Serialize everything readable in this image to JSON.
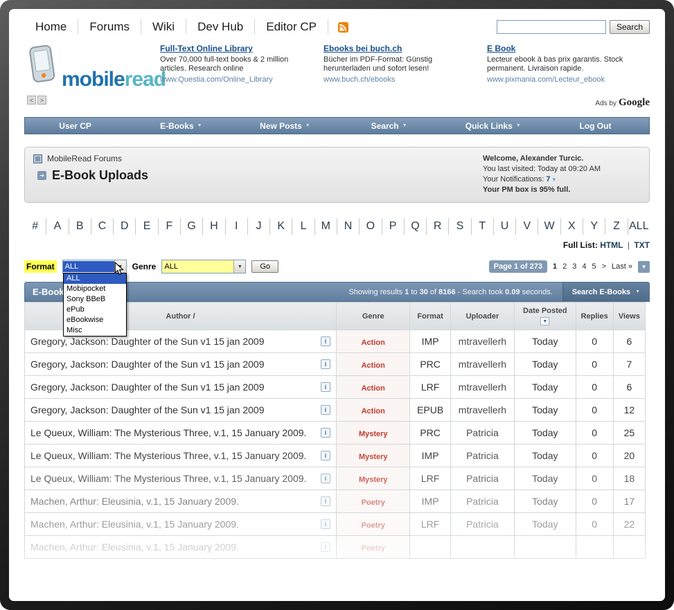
{
  "topnav": {
    "items": [
      "Home",
      "Forums",
      "Wiki",
      "Dev Hub",
      "Editor CP"
    ],
    "search_value": "",
    "search_button": "Search"
  },
  "logo": {
    "text_mobile": "mobile",
    "text_read": "read",
    "pager_prev": "<",
    "pager_next": ">"
  },
  "ads": {
    "byline_prefix": "Ads by",
    "byline_brand": "Google",
    "items": [
      {
        "title": "Full-Text Online Library",
        "body": "Over 70,000 full-text books & 2 million articles. Research online",
        "url": "www.Questia.com/Online_Library"
      },
      {
        "title": "Ebooks bei buch.ch",
        "body": "Bücher im PDF-Format: Günstig herunterladen und sofort lesen!",
        "url": "www.buch.ch/ebooks"
      },
      {
        "title": "E Book",
        "body": "Lecteur ebook à bas prix garantis. Stock permanent. Livraison rapide.",
        "url": "www.pixmania.com/Lecteur_ebook"
      }
    ]
  },
  "menubar": {
    "items": [
      {
        "label": "User CP",
        "arrow": ""
      },
      {
        "label": "E-Books",
        "arrow": "▼"
      },
      {
        "label": "New Posts",
        "arrow": "▼"
      },
      {
        "label": "Search",
        "arrow": "▼"
      },
      {
        "label": "Quick Links",
        "arrow": "▼"
      },
      {
        "label": "Log Out",
        "arrow": ""
      }
    ]
  },
  "breadcrumb": {
    "site": "MobileRead Forums",
    "title": "E-Book Uploads"
  },
  "welcome": {
    "greeting_prefix": "Welcome, ",
    "username": "Alexander Turcic",
    "greeting_suffix": ".",
    "last_visit": "You last visited: Today at 09:20 AM",
    "notifications_label": "Your Notifications: ",
    "notifications_count": "7",
    "pm_status": "Your PM box is 95% full."
  },
  "alphabet": [
    "#",
    "A",
    "B",
    "C",
    "D",
    "E",
    "F",
    "G",
    "H",
    "I",
    "J",
    "K",
    "L",
    "M",
    "N",
    "O",
    "P",
    "Q",
    "R",
    "S",
    "T",
    "U",
    "V",
    "W",
    "X",
    "Y",
    "Z",
    "ALL"
  ],
  "full_list": {
    "label": "Full List:",
    "html_link": "HTML",
    "separator": "|",
    "txt_link": "TXT"
  },
  "filters": {
    "format_label": "Format",
    "format_value": "ALL",
    "format_options": [
      "ALL",
      "Mobipocket",
      "Sony BBeB",
      "ePub",
      "eBookwise",
      "Misc"
    ],
    "genre_label": "Genre",
    "genre_value": "ALL",
    "go_button": "Go"
  },
  "pagination": {
    "badge": "Page 1 of 273",
    "pages": [
      "1",
      "2",
      "3",
      "4",
      "5"
    ],
    "next_link": ">",
    "last_link": "Last »"
  },
  "results_header": {
    "title": "E-Book Uploads",
    "summary": {
      "pre": "Showing results ",
      "from": "1",
      "mid1": " to ",
      "to": "30",
      "mid2": " of ",
      "total": "8166",
      "mid3": " - Search took ",
      "time": "0.09",
      "post": " seconds."
    },
    "search_button": "Search E-Books"
  },
  "table": {
    "headers": [
      "Author /",
      "Genre",
      "Format",
      "Uploader",
      "Date Posted",
      "Replies",
      "Views"
    ],
    "rows": [
      {
        "title": "Gregory, Jackson: Daughter of the Sun v1 15 jan 2009",
        "genre": "Action",
        "format": "IMP",
        "uploader": "mtravellerh",
        "date": "Today",
        "replies": "0",
        "views": "6"
      },
      {
        "title": "Gregory, Jackson: Daughter of the Sun v1 15 jan 2009",
        "genre": "Action",
        "format": "PRC",
        "uploader": "mtravellerh",
        "date": "Today",
        "replies": "0",
        "views": "7"
      },
      {
        "title": "Gregory, Jackson: Daughter of the Sun v1 15 jan 2009",
        "genre": "Action",
        "format": "LRF",
        "uploader": "mtravellerh",
        "date": "Today",
        "replies": "0",
        "views": "6"
      },
      {
        "title": "Gregory, Jackson: Daughter of the Sun v1 15 jan 2009",
        "genre": "Action",
        "format": "EPUB",
        "uploader": "mtravellerh",
        "date": "Today",
        "replies": "0",
        "views": "12"
      },
      {
        "title": "Le Queux, William: The Mysterious Three, v.1, 15 January 2009.",
        "genre": "Mystery",
        "format": "PRC",
        "uploader": "Patricia",
        "date": "Today",
        "replies": "0",
        "views": "25"
      },
      {
        "title": "Le Queux, William: The Mysterious Three, v.1, 15 January 2009.",
        "genre": "Mystery",
        "format": "IMP",
        "uploader": "Patricia",
        "date": "Today",
        "replies": "0",
        "views": "20"
      },
      {
        "title": "Le Queux, William: The Mysterious Three, v.1, 15 January 2009.",
        "genre": "Mystery",
        "format": "LRF",
        "uploader": "Patricia",
        "date": "Today",
        "replies": "0",
        "views": "18"
      },
      {
        "title": "Machen, Arthur: Eleusinia, v.1, 15 January 2009.",
        "genre": "Poetry",
        "format": "IMP",
        "uploader": "Patricia",
        "date": "Today",
        "replies": "0",
        "views": "17"
      },
      {
        "title": "Machen, Arthur: Eleusinia, v.1, 15 January 2009.",
        "genre": "Poetry",
        "format": "LRF",
        "uploader": "Patricia",
        "date": "Today",
        "replies": "0",
        "views": "22"
      },
      {
        "title": "Machen, Arthur: Eleusinia, v.1, 15 January 2009.",
        "genre": "Poetry",
        "format": "",
        "uploader": "",
        "date": "",
        "replies": "",
        "views": ""
      }
    ]
  }
}
